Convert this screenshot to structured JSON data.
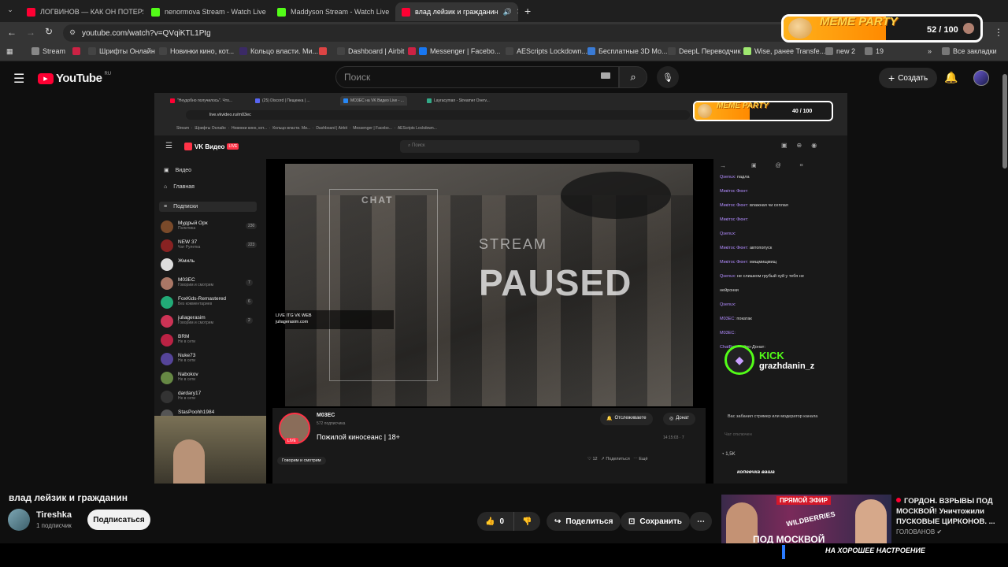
{
  "browser": {
    "tabs": [
      {
        "title": "ЛОГВИНОВ — КАК ОН ПОТЕРЯ",
        "fav_color": "#ff0033"
      },
      {
        "title": "nenormova Stream - Watch Live",
        "fav_color": "#53fc18"
      },
      {
        "title": "Maddyson Stream - Watch Live",
        "fav_color": "#53fc18"
      },
      {
        "title": "влад лейзик и гражданин",
        "fav_color": "#ff0033"
      }
    ],
    "new_tab": "+",
    "url": "youtube.com/watch?v=QVqiKTL1Ptg",
    "bookmarks": [
      {
        "label": "Stream",
        "color": "#888"
      },
      {
        "label": "",
        "color": "#cc2244"
      },
      {
        "label": "Шрифты Онлайн",
        "color": "#444"
      },
      {
        "label": "Новинки кино, кот...",
        "color": "#444"
      },
      {
        "label": "Кольцо власти. Ми...",
        "color": "#3b2a66"
      },
      {
        "label": "",
        "color": "#d44"
      },
      {
        "label": "Dashboard | Airbit",
        "color": "#444"
      },
      {
        "label": "Messenger | Facebo...",
        "color": "#cc2244"
      },
      {
        "label": "",
        "color": "#1877f2"
      },
      {
        "label": "AEScripts Lockdown...",
        "color": "#444"
      },
      {
        "label": "Бесплатные 3D Мо...",
        "color": "#3a7bd5"
      },
      {
        "label": "DeepL Переводчик",
        "color": "#444"
      },
      {
        "label": "Wise, ранее Transfe...",
        "color": "#9fe870"
      },
      {
        "label": "new 2",
        "color": "#777"
      },
      {
        "label": "19",
        "color": "#777"
      }
    ],
    "all_bookmarks": "Все закладки"
  },
  "meme_party": {
    "logo": "MEME PARTY",
    "count": "52 / 100",
    "progress": 0.52
  },
  "youtube": {
    "logo": "YouTube",
    "region": "RU",
    "search_placeholder": "Поиск",
    "create_label": "Создать"
  },
  "inner": {
    "tabs": [
      "\"Неудобно получилось\". Что...",
      "(25) Discord | Пещенка | ...",
      "MO3EC на VK Видео Live - ...",
      "Layracyman - Streamer Overv..."
    ],
    "url": "live.vkvideo.ru/m03ec",
    "meme_count": "40 / 100",
    "vk_logo": "VK Видео",
    "live_badge": "LIVE",
    "search_placeholder": "Поиск",
    "nav": [
      "Видео",
      "Главная",
      "Подписки"
    ],
    "channels": [
      {
        "name": "Мудрый Орк",
        "sub": "Политика",
        "count": "230",
        "color": "#7a4a2a"
      },
      {
        "name": "NEW 37",
        "sub": "Чат Рулетка",
        "count": "223",
        "color": "#882222"
      },
      {
        "name": "Жмиль",
        "sub": "",
        "count": "",
        "color": "#dddddd"
      },
      {
        "name": "M03EC",
        "sub": "Говорим и смотрим",
        "count": "7",
        "color": "#aa7766"
      },
      {
        "name": "FoxKids-Remastered",
        "sub": "Без комментариев",
        "count": "6",
        "color": "#22aa77"
      },
      {
        "name": "juliagerasim",
        "sub": "Говорим и смотрим",
        "count": "2",
        "color": "#cc3355"
      },
      {
        "name": "BRM",
        "sub": "Не в сети",
        "count": "",
        "color": "#bb2244"
      },
      {
        "name": "Nuke73",
        "sub": "Не в сети",
        "count": "",
        "color": "#554499"
      },
      {
        "name": "Nabokov",
        "sub": "Не в сети",
        "count": "",
        "color": "#668844"
      },
      {
        "name": "dardary17",
        "sub": "Не в сети",
        "count": "",
        "color": "#333333"
      },
      {
        "name": "StasPoohh1984",
        "sub": "",
        "count": "",
        "color": "#555555"
      }
    ],
    "stream_overlay": {
      "chat_title": "CHAT",
      "stream_word": "STREAM",
      "paused_word": "PAUSED",
      "platforms": "LIVE  ITG  VK  WEB",
      "handle": "juliagerasim.com"
    },
    "streamer": {
      "name": "M03EC",
      "subs": "572 подписчика",
      "title": "Пожилой киносеанс | 18+",
      "category": "Говорим и смотрим",
      "time": "14:15:03",
      "viewers": "7",
      "follow": "Отслеживаете",
      "donate": "Донат",
      "likes": "12",
      "share": "Поделиться",
      "more": "Ещё",
      "live": "LIVE"
    },
    "chat": [
      {
        "user": "Qsenux:",
        "text": "падла"
      },
      {
        "user": "Микітос Фюнт:",
        "text": ""
      },
      {
        "user": "Микітос Фюнт:",
        "text": "влажная чи сеплая"
      },
      {
        "user": "Микітос Фюнт:",
        "text": ""
      },
      {
        "user": "Qsenux:",
        "text": ""
      },
      {
        "user": "Микітос Фюнт:",
        "text": "автопопуск"
      },
      {
        "user": "Микітос Фюнт:",
        "text": "мищмищмищ"
      },
      {
        "user": "Qsenux:",
        "text": "не слишком грубый хуй у тебя не"
      },
      {
        "user": "",
        "text": "нейронки"
      },
      {
        "user": "Qsenux:",
        "text": ""
      },
      {
        "user": "M03EC:",
        "text": "покатак"
      },
      {
        "user": "M03EC:",
        "text": ""
      },
      {
        "user": "ChatBot:",
        "text": "Нейро-Донат:"
      }
    ],
    "chat_banned": "Вас забанил стример или модератор канала",
    "chat_input": "Чат отключен",
    "chat_points": "1,5K",
    "kick_brand": "KICK",
    "kick_user": "grazhdanin_z",
    "tagline": "копеечка ваша"
  },
  "video_meta": {
    "title": "влад лейзик и гражданин",
    "channel": "Tireshka",
    "subscribers": "1 подписчик",
    "subscribe": "Подписаться",
    "likes": "0",
    "share": "Поделиться",
    "save": "Сохранить"
  },
  "recommendation": {
    "badge": "ПРЯМОЙ ЭФИР",
    "title": "ГОРДОН. ВЗРЫВЫ ПОД МОСКВОЙ! Уничтожили ПУСКОВЫЕ ЦИРКОНОВ. ...",
    "channel": "ГОЛОВАНОВ",
    "thumb_text": "ПОД МОСКВОЙ",
    "thumb_brand": "WILDBERRIES"
  },
  "bottom_tagline": "НА ХОРОШЕЕ НАСТРОЕНИЕ"
}
